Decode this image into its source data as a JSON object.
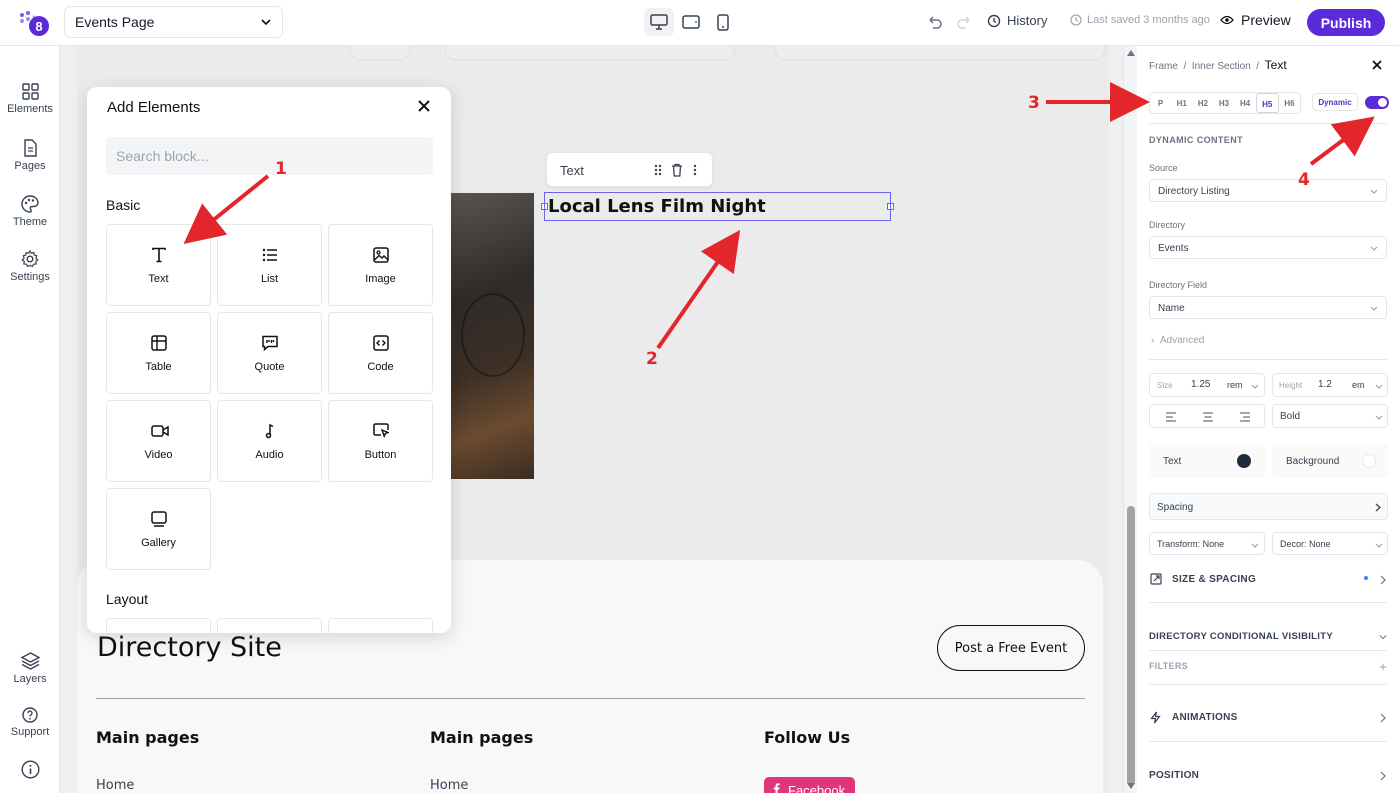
{
  "header": {
    "page_name": "Events Page",
    "history_label": "History",
    "last_saved": "Last saved 3 months ago",
    "preview_label": "Preview",
    "publish_label": "Publish"
  },
  "sidebar": {
    "items": [
      {
        "label": "Elements",
        "icon": "grid-icon"
      },
      {
        "label": "Pages",
        "icon": "page-icon"
      },
      {
        "label": "Theme",
        "icon": "palette-icon"
      },
      {
        "label": "Settings",
        "icon": "gear-icon"
      }
    ],
    "bottom_items": [
      {
        "label": "Layers",
        "icon": "layers-icon"
      },
      {
        "label": "Support",
        "icon": "help-icon"
      },
      {
        "label": "",
        "icon": "info-icon"
      }
    ]
  },
  "add_elements": {
    "title": "Add Elements",
    "search_placeholder": "Search block...",
    "basic_label": "Basic",
    "layout_label": "Layout",
    "tiles": [
      {
        "label": "Text",
        "icon": "text-icon"
      },
      {
        "label": "List",
        "icon": "list-icon"
      },
      {
        "label": "Image",
        "icon": "image-icon"
      },
      {
        "label": "Table",
        "icon": "table-icon"
      },
      {
        "label": "Quote",
        "icon": "quote-icon"
      },
      {
        "label": "Code",
        "icon": "code-icon"
      },
      {
        "label": "Video",
        "icon": "video-icon"
      },
      {
        "label": "Audio",
        "icon": "audio-icon"
      },
      {
        "label": "Button",
        "icon": "button-icon"
      },
      {
        "label": "Gallery",
        "icon": "gallery-icon"
      }
    ]
  },
  "canvas": {
    "toolbar_label": "Text",
    "selected_text": "Local Lens Film Night",
    "footer_title": "Directory Site",
    "post_button": "Post a Free Event",
    "footer_cols": [
      {
        "heading": "Main pages",
        "first_link": "Home"
      },
      {
        "heading": "Main pages",
        "first_link": "Home"
      },
      {
        "heading": "Follow Us",
        "first_link": "Facebook"
      }
    ]
  },
  "inspector": {
    "breadcrumb": [
      "Frame",
      "Inner Section",
      "Text"
    ],
    "tags": [
      "P",
      "H1",
      "H2",
      "H3",
      "H4",
      "H5",
      "H6"
    ],
    "active_tag": "H5",
    "dynamic_label": "Dynamic",
    "dynamic_on": true,
    "dynamic_heading": "DYNAMIC CONTENT",
    "source_label": "Source",
    "source_value": "Directory Listing",
    "directory_label": "Directory",
    "directory_value": "Events",
    "field_label": "Directory Field",
    "field_value": "Name",
    "advanced_label": "Advanced",
    "size_label": "Size",
    "size_value": "1.25",
    "size_unit": "rem",
    "height_label": "Height",
    "height_value": "1.2",
    "height_unit": "em",
    "weight_value": "Bold",
    "text_color_label": "Text",
    "bg_label": "Background",
    "spacing_label": "Spacing",
    "transform_value": "Transform: None",
    "decor_value": "Decor: None",
    "size_spacing_heading": "SIZE & SPACING",
    "visibility_heading": "DIRECTORY CONDITIONAL VISIBILITY",
    "filters_heading": "FILTERS",
    "animations_heading": "ANIMATIONS",
    "position_heading": "POSITION",
    "colors": {
      "text": "#1e293b",
      "accent": "#5b2bd9"
    }
  },
  "annotations": [
    "1",
    "2",
    "3",
    "4"
  ]
}
